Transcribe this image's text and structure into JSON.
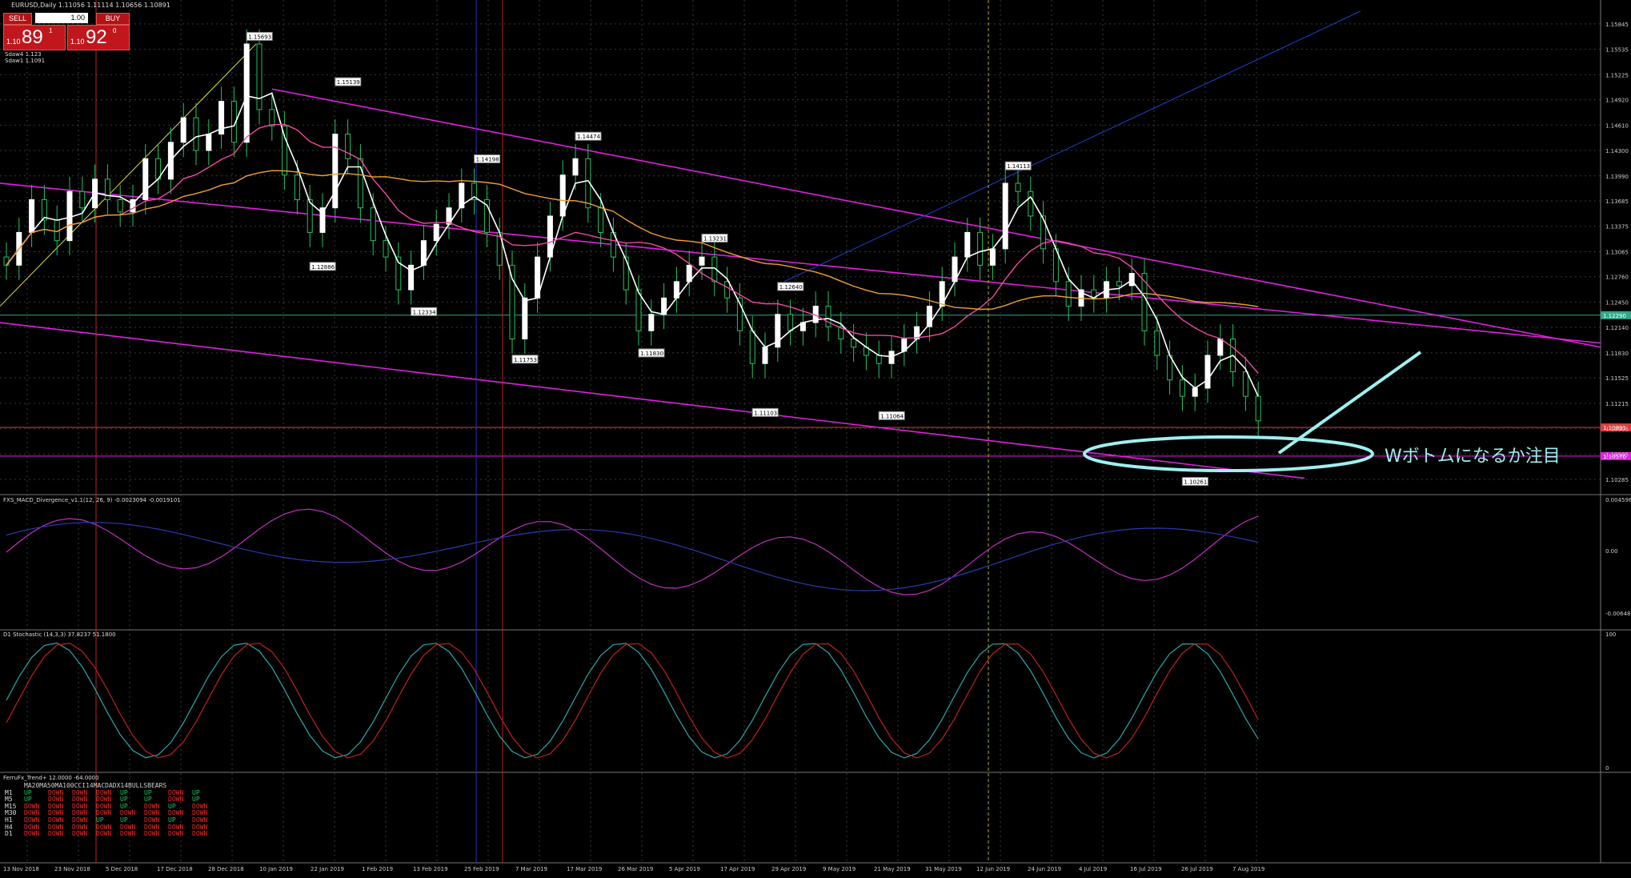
{
  "window": {
    "symbol_line": "EURUSD,Daily  1.11056 1.11114 1.10656 1.10891"
  },
  "trade_panel": {
    "sell_label": "SELL",
    "buy_label": "BUY",
    "lot": "1.00",
    "sell_prefix": "1.10",
    "sell_big": "89",
    "sell_sup": "1",
    "buy_prefix": "1.10",
    "buy_big": "92",
    "buy_sup": "0"
  },
  "sma_labels": [
    "Sdaw4 1.123",
    "Sdaw1 1.1091"
  ],
  "annotation": {
    "text": "Wボトムになるか注目",
    "color": "#9ef0f0"
  },
  "panels": {
    "macd_title": "FXS_MACD_Divergence_v1.1(12, 26, 9) -0.0023094 -0.0019101",
    "macd_levels": [
      "0.0045963",
      "0.00",
      "-0.006480"
    ],
    "stoch_title": "D1 Stochastic (14,3,3) 37.8237 51.1800",
    "stoch_levels": [
      "100",
      "0"
    ],
    "trend_title": "FerruFx_Trend+ 12.0000 -64.0000"
  },
  "trend_table": {
    "headers": [
      "MA20",
      "MA50",
      "MA100",
      "CCI14",
      "MACD",
      "ADX14",
      "BULLS",
      "BEARS"
    ],
    "rows": [
      {
        "tf": "M1",
        "cells": [
          "UP",
          "DOWN",
          "DOWN",
          "DOWN",
          "UP",
          "UP",
          "DOWN",
          "UP"
        ]
      },
      {
        "tf": "M5",
        "cells": [
          "UP",
          "DOWN",
          "DOWN",
          "DOWN",
          "UP",
          "UP",
          "DOWN",
          "UP"
        ]
      },
      {
        "tf": "M15",
        "cells": [
          "DOWN",
          "DOWN",
          "DOWN",
          "DOWN",
          "UP",
          "DOWN",
          "UP",
          "DOWN"
        ]
      },
      {
        "tf": "M30",
        "cells": [
          "DOWN",
          "DOWN",
          "DOWN",
          "DOWN",
          "DOWN",
          "DOWN",
          "DOWN",
          "DOWN"
        ]
      },
      {
        "tf": "H1",
        "cells": [
          "DOWN",
          "DOWN",
          "DOWN",
          "UP",
          "UP",
          "DOWN",
          "UP",
          "DOWN"
        ]
      },
      {
        "tf": "H4",
        "cells": [
          "DOWN",
          "DOWN",
          "DOWN",
          "DOWN",
          "DOWN",
          "DOWN",
          "DOWN",
          "DOWN"
        ]
      },
      {
        "tf": "D1",
        "cells": [
          "DOWN",
          "DOWN",
          "DOWN",
          "DOWN",
          "DOWN",
          "DOWN",
          "DOWN",
          "DOWN"
        ]
      }
    ]
  },
  "colors": {
    "up": "#22c55e",
    "down": "#ef2b2b",
    "magenta": "#e020e0",
    "orange": "#f0a030",
    "pink": "#f04aa0",
    "cyan": "#9ef0f0",
    "grid": "#3a3a3a"
  },
  "chart_data": {
    "type": "candlestick",
    "symbol": "EURUSD",
    "timeframe": "Daily",
    "ylim": [
      1.101,
      1.16
    ],
    "y_ticks": [
      1.15845,
      1.15535,
      1.15225,
      1.1492,
      1.1461,
      1.143,
      1.1399,
      1.13685,
      1.13375,
      1.13065,
      1.1276,
      1.1245,
      1.1214,
      1.1183,
      1.11525,
      1.11215,
      1.10905,
      1.10595,
      1.10285
    ],
    "x_labels": [
      "13 Nov 2018",
      "23 Nov 2018",
      "5 Dec 2018",
      "17 Dec 2018",
      "28 Dec 2018",
      "10 Jan 2019",
      "22 Jan 2019",
      "1 Feb 2019",
      "13 Feb 2019",
      "25 Feb 2019",
      "7 Mar 2019",
      "17 Mar 2019",
      "26 Mar 2019",
      "5 Apr 2019",
      "17 Apr 2019",
      "29 Apr 2019",
      "9 May 2019",
      "21 May 2019",
      "31 May 2019",
      "12 Jun 2019",
      "24 Jun 2019",
      "4 Jul 2019",
      "16 Jul 2019",
      "26 Jul 2019",
      "7 Aug 2019"
    ],
    "price_labels": [
      {
        "text": "1.15693",
        "i": 19,
        "price": 1.15693
      },
      {
        "text": "1.15139",
        "i": 26,
        "price": 1.15139
      },
      {
        "text": "1.14198",
        "i": 37,
        "price": 1.14198
      },
      {
        "text": "1.14474",
        "i": 45,
        "price": 1.14474
      },
      {
        "text": "1.12886",
        "i": 24,
        "price": 1.12886
      },
      {
        "text": "1.12334",
        "i": 32,
        "price": 1.12334
      },
      {
        "text": "1.11753",
        "i": 40,
        "price": 1.11753
      },
      {
        "text": "1.13231",
        "i": 55,
        "price": 1.13231
      },
      {
        "text": "1.11830",
        "i": 50,
        "price": 1.1183
      },
      {
        "text": "1.12640",
        "i": 61,
        "price": 1.1264
      },
      {
        "text": "1.11103",
        "i": 59,
        "price": 1.11103
      },
      {
        "text": "1.11064",
        "i": 69,
        "price": 1.11064
      },
      {
        "text": "1.14113",
        "i": 79,
        "price": 1.14113
      },
      {
        "text": "1.10261",
        "i": 93,
        "price": 1.10261
      }
    ],
    "current_price": "1.10891",
    "hlines": [
      {
        "price": 1.1229,
        "label": "1.12290"
      },
      {
        "price": 1.1092,
        "label": "1.10891"
      },
      {
        "price": 1.1057,
        "label": "1.10570"
      }
    ],
    "closes": [
      1.129,
      1.133,
      1.137,
      1.1345,
      1.132,
      1.138,
      1.136,
      1.1395,
      1.137,
      1.1355,
      1.137,
      1.142,
      1.1395,
      1.144,
      1.147,
      1.143,
      1.145,
      1.149,
      1.144,
      1.156,
      1.148,
      1.146,
      1.14,
      1.137,
      1.133,
      1.136,
      1.145,
      1.142,
      1.136,
      1.132,
      1.13,
      1.126,
      1.129,
      1.132,
      1.134,
      1.136,
      1.139,
      1.137,
      1.133,
      1.129,
      1.12,
      1.125,
      1.13,
      1.135,
      1.14,
      1.142,
      1.136,
      1.133,
      1.13,
      1.126,
      1.121,
      1.123,
      1.125,
      1.127,
      1.129,
      1.13,
      1.127,
      1.125,
      1.121,
      1.117,
      1.119,
      1.123,
      1.121,
      1.122,
      1.124,
      1.1215,
      1.12,
      1.119,
      1.118,
      1.117,
      1.1185,
      1.12,
      1.1215,
      1.124,
      1.127,
      1.13,
      1.133,
      1.129,
      1.131,
      1.139,
      1.138,
      1.135,
      1.131,
      1.127,
      1.124,
      1.126,
      1.125,
      1.127,
      1.1265,
      1.128,
      1.121,
      1.118,
      1.115,
      1.113,
      1.114,
      1.118,
      1.12,
      1.116,
      1.113,
      1.11
    ],
    "opens": [
      1.13,
      1.129,
      1.133,
      1.137,
      1.1345,
      1.132,
      1.138,
      1.136,
      1.1395,
      1.137,
      1.1355,
      1.137,
      1.142,
      1.1395,
      1.144,
      1.147,
      1.143,
      1.145,
      1.149,
      1.144,
      1.156,
      1.148,
      1.146,
      1.14,
      1.137,
      1.133,
      1.136,
      1.145,
      1.142,
      1.136,
      1.132,
      1.13,
      1.126,
      1.129,
      1.132,
      1.134,
      1.136,
      1.139,
      1.137,
      1.133,
      1.129,
      1.12,
      1.125,
      1.13,
      1.135,
      1.14,
      1.142,
      1.136,
      1.133,
      1.13,
      1.126,
      1.121,
      1.123,
      1.125,
      1.127,
      1.129,
      1.13,
      1.127,
      1.125,
      1.121,
      1.117,
      1.119,
      1.123,
      1.121,
      1.122,
      1.124,
      1.1215,
      1.12,
      1.119,
      1.118,
      1.117,
      1.1185,
      1.12,
      1.1215,
      1.124,
      1.127,
      1.13,
      1.133,
      1.129,
      1.131,
      1.139,
      1.138,
      1.135,
      1.131,
      1.127,
      1.124,
      1.126,
      1.125,
      1.127,
      1.1265,
      1.128,
      1.121,
      1.118,
      1.115,
      1.113,
      1.114,
      1.118,
      1.12,
      1.116,
      1.113
    ]
  }
}
